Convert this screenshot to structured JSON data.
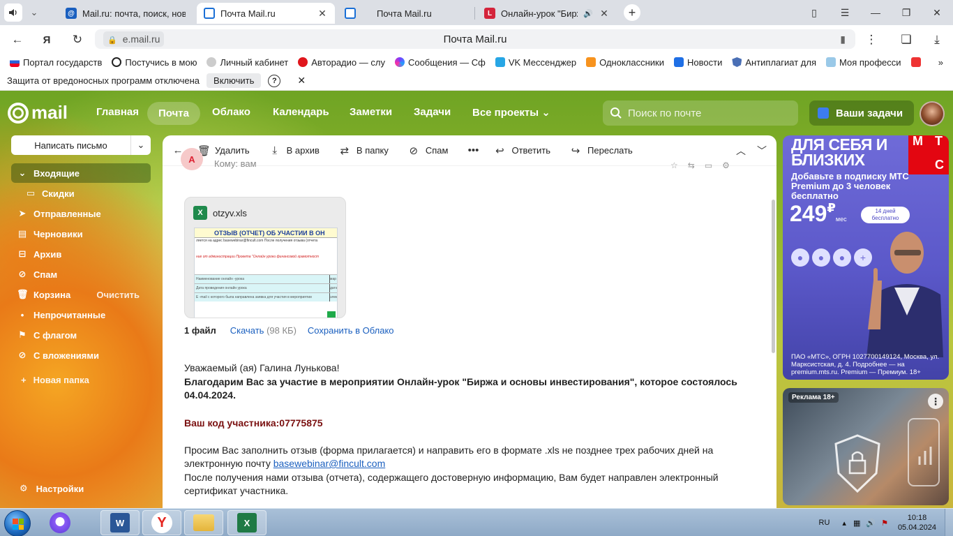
{
  "browser": {
    "tabs": [
      {
        "title": "Mail.ru: почта, поиск, нов",
        "active": false
      },
      {
        "title": "Почта Mail.ru",
        "active": true
      },
      {
        "title": "Почта Mail.ru",
        "active": false
      },
      {
        "title": "Онлайн-урок \"Бирж",
        "active": false
      }
    ],
    "url_domain": "e.mail.ru",
    "page_title": "Почта Mail.ru",
    "bookmarks": [
      "Портал государств",
      "Постучись в мою",
      "Личный кабинет",
      "Авторадио — слу",
      "Сообщения — Сф",
      "VK Мессенджер",
      "Одноклассники",
      "Новости",
      "Антиплагиат для",
      "Моя професси"
    ],
    "warning": {
      "text": "Защита от вредоносных программ отключена",
      "button": "Включить",
      "help": "?"
    }
  },
  "mail_nav": {
    "logo": "mail",
    "links": [
      "Главная",
      "Почта",
      "Облако",
      "Календарь",
      "Заметки",
      "Задачи",
      "Все проекты"
    ],
    "search_placeholder": "Поиск по почте",
    "tasks_button": "Ваши задачи"
  },
  "sidebar": {
    "compose": "Написать письмо",
    "folders": [
      {
        "label": "Входящие",
        "icon": "chevron-down-icon"
      },
      {
        "label": "Скидки",
        "icon": "folder-icon"
      },
      {
        "label": "Отправленные",
        "icon": "send-icon"
      },
      {
        "label": "Черновики",
        "icon": "draft-icon"
      },
      {
        "label": "Архив",
        "icon": "archive-icon"
      },
      {
        "label": "Спам",
        "icon": "spam-icon"
      },
      {
        "label": "Корзина",
        "icon": "trash-icon",
        "extra": "Очистить"
      },
      {
        "label": "Непрочитанные",
        "icon": "dot-icon"
      },
      {
        "label": "С флагом",
        "icon": "flag-icon"
      },
      {
        "label": "С вложениями",
        "icon": "clip-icon"
      }
    ],
    "new_folder": "Новая папка",
    "settings": "Настройки"
  },
  "toolbar": {
    "delete": "Удалить",
    "archive": "В архив",
    "to_folder": "В папку",
    "spam": "Спам",
    "reply": "Ответить",
    "forward": "Переслать"
  },
  "letter": {
    "sender_initial": "А",
    "to": "Кому: вам",
    "attachment": {
      "filename": "otzyv.xls",
      "preview_title": "ОТЗЫВ (ОТЧЕТ) ОБ УЧАСТИИ В ОН",
      "preview_line": "ляется на адрес basewebinar@fincult.com После получения отзыва (отчета",
      "preview_red": "ние от администрации Проекта \"Онлайн уроки финансовой грамотност",
      "preview_rows": [
        {
          "label": "Наименование онлайн -урока",
          "value": "мар"
        },
        {
          "label": "Дата проведения онлайн урока",
          "value": "дата"
        },
        {
          "label": "E -mail с которого была направлена заявка для участия в мероприятии",
          "value": "элек"
        }
      ],
      "count": "1 файл",
      "download": "Скачать",
      "size": "(98 КБ)",
      "save_cloud": "Сохранить в Облако"
    },
    "greeting": "Уважаемый (ая) Галина Лунькова!",
    "thanks": "Благодарим Вас за участие в мероприятии Онлайн-урок \"Биржа и основы инвестирования\", которое состоялось 04.04.2024.",
    "code": "Ваш код участника:07775875",
    "request_prefix": "Просим Вас заполнить отзыв (форма прилагается) и направить его в формате .xls не позднее трех рабочих дней на электронную почту ",
    "email": "basewebinar@fincult.com",
    "after": "После получения нами отзыва (отчета), содержащего достоверную информацию, Вам будет направлен электронный сертификат участника."
  },
  "ad_mts": {
    "headline": "ДЛЯ СЕБЯ И БЛИЗКИХ",
    "brand_letters": [
      "М",
      "Т",
      "С"
    ],
    "subline": "Добавьте в подписку МТС Premium до 3 человек бесплатно",
    "price": "249",
    "currency": "₽",
    "per": "мес",
    "pill": "14 дней бесплатно",
    "legal": "ПАО «МТС», ОГРН 1027700149124, Москва, ул. Марксистская, д. 4. Подробнее — на premium.mts.ru. Premium — Премиум. 18+"
  },
  "ad_second": {
    "label": "Реклама 18+"
  },
  "taskbar": {
    "lang": "RU",
    "time": "10:18",
    "date": "05.04.2024"
  }
}
